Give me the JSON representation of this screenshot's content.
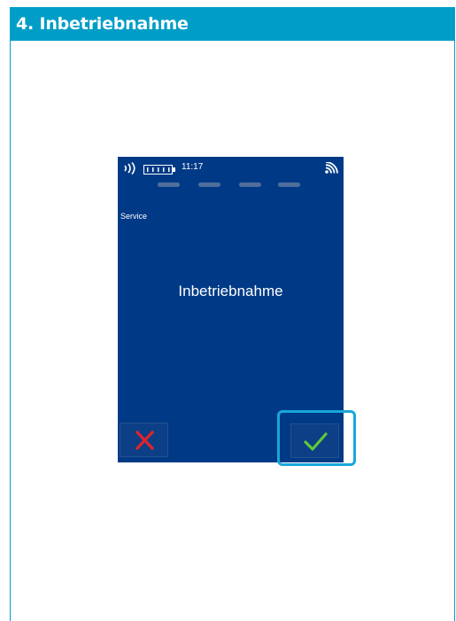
{
  "header": {
    "title": "4. Inbetriebnahme"
  },
  "device": {
    "status_bar": {
      "contactless_icon": "contactless-icon",
      "battery_icon": "battery-icon",
      "time": "11:17",
      "signal_icon": "signal-icon"
    },
    "pin_dots_count": 4,
    "menu_label": "Service",
    "screen_title": "Inbetriebnahme",
    "cancel_button_icon": "close-icon",
    "confirm_button_icon": "checkmark-icon"
  },
  "colors": {
    "accent": "#009ec7",
    "highlight": "#18a7d9",
    "screen_background": "#003a86",
    "cancel": "#e0242c",
    "confirm": "#5fc93a"
  }
}
